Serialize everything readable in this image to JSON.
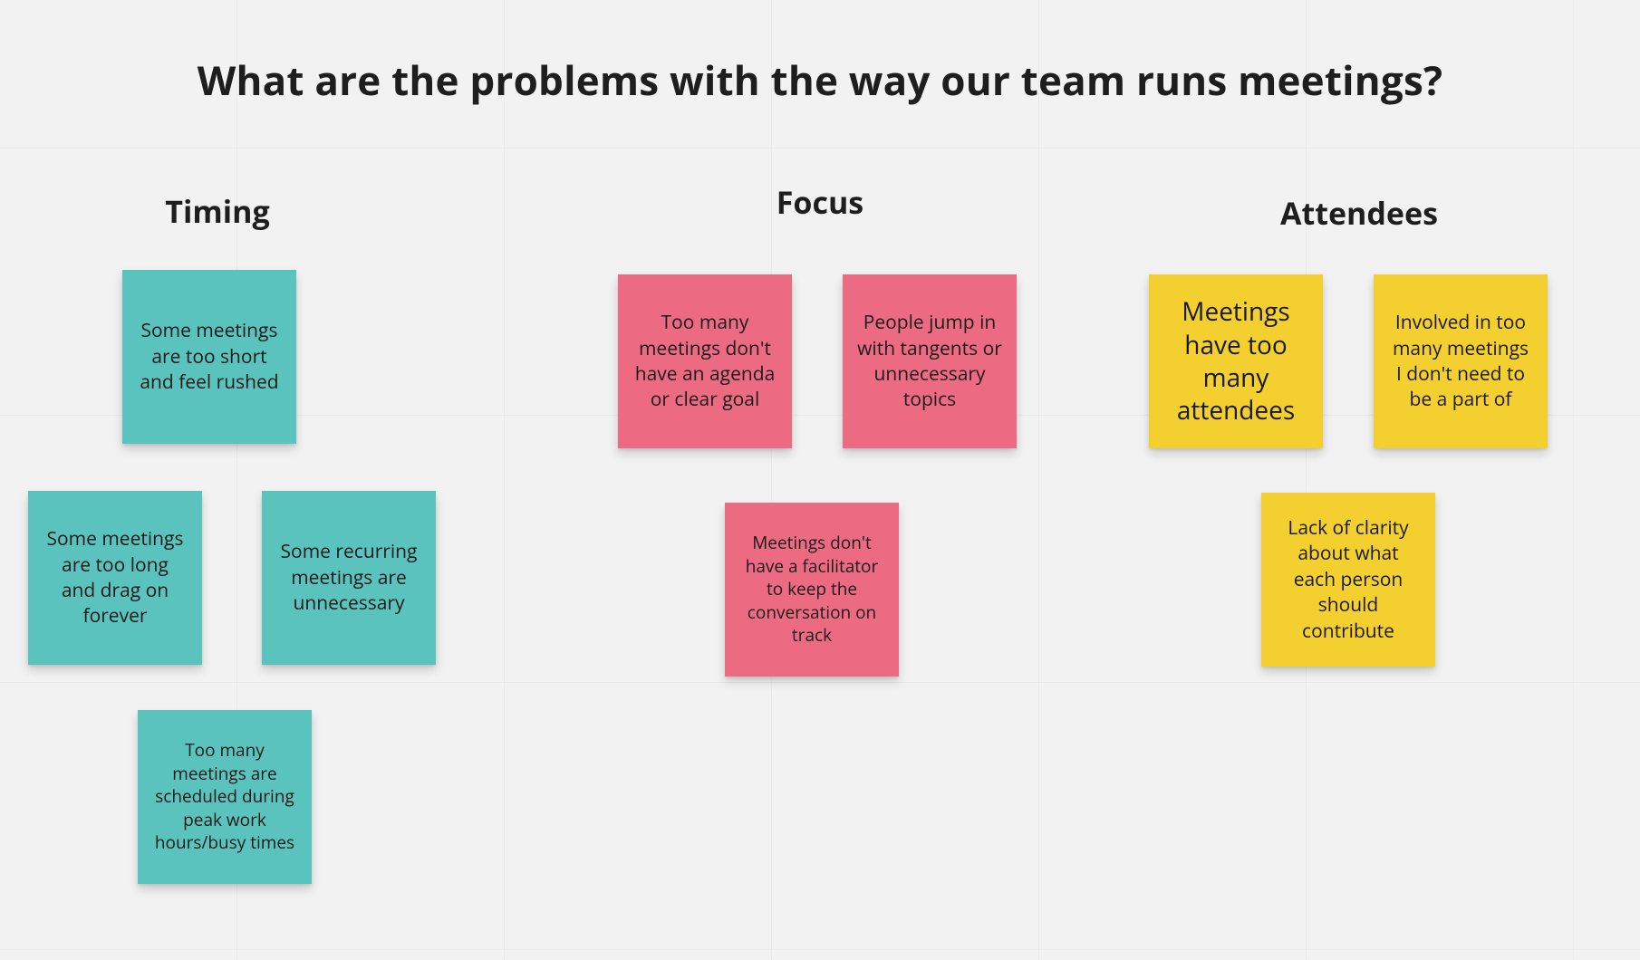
{
  "title": "What are the problems with the way our team runs meetings?",
  "categories": {
    "timing": {
      "label": "Timing"
    },
    "focus": {
      "label": "Focus"
    },
    "attendees": {
      "label": "Attendees"
    }
  },
  "notes": {
    "timing_short": "Some meetings are too short and feel rushed",
    "timing_long": "Some meetings are too long and drag on forever",
    "timing_recurring": "Some recurring meetings are unnecessary",
    "timing_peak": "Too many meetings are scheduled during peak work hours/busy times",
    "focus_agenda": "Too many meetings don't have an agenda or clear goal",
    "focus_tangents": "People jump in with tangents or unnecessary topics",
    "focus_facilitator": "Meetings don't have a facilitator to keep the conversation on track",
    "attendees_too_many": "Meetings have too many attendees",
    "attendees_involved": "Involved in too many meetings I don't need to be a part of",
    "attendees_clarity": "Lack of clarity about what each person should contribute"
  },
  "colors": {
    "teal": "#5ac3bd",
    "pink": "#ed6B82",
    "yellow": "#f4cf30"
  }
}
